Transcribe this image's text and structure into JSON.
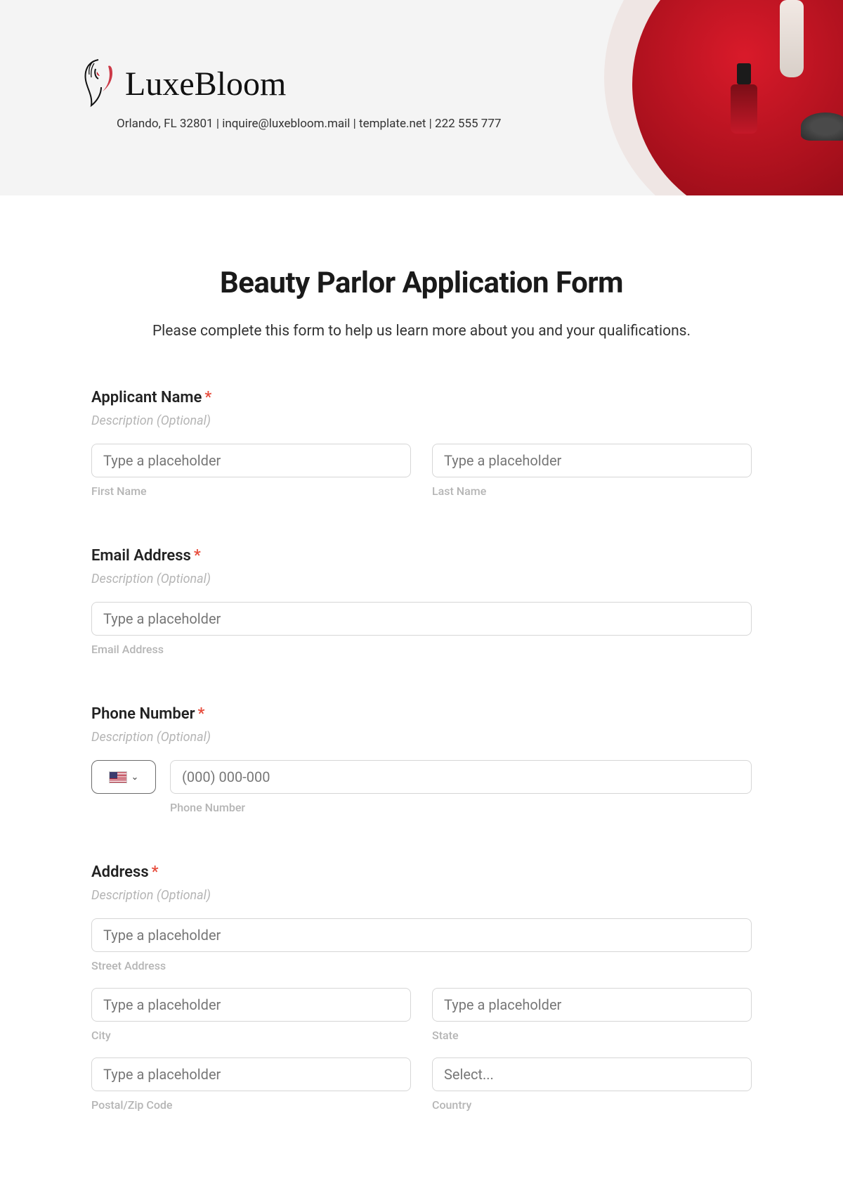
{
  "brand": {
    "name": "LuxeBloom",
    "subline": "Orlando, FL 32801 | inquire@luxebloom.mail | template.net | 222 555 777"
  },
  "form": {
    "title": "Beauty Parlor Application Form",
    "intro": "Please complete this form to help us learn more about you and your qualifications."
  },
  "common": {
    "desc_optional": "Description (Optional)",
    "placeholder": "Type a placeholder",
    "select_placeholder": "Select..."
  },
  "applicant": {
    "label": "Applicant Name",
    "first_sub": "First Name",
    "last_sub": "Last Name"
  },
  "email": {
    "label": "Email Address",
    "sub": "Email Address"
  },
  "phone": {
    "label": "Phone Number",
    "placeholder": "(000) 000-000",
    "sub": "Phone Number"
  },
  "address": {
    "label": "Address",
    "street_sub": "Street Address",
    "city_sub": "City",
    "state_sub": "State",
    "postal_sub": "Postal/Zip Code",
    "country_sub": "Country"
  }
}
